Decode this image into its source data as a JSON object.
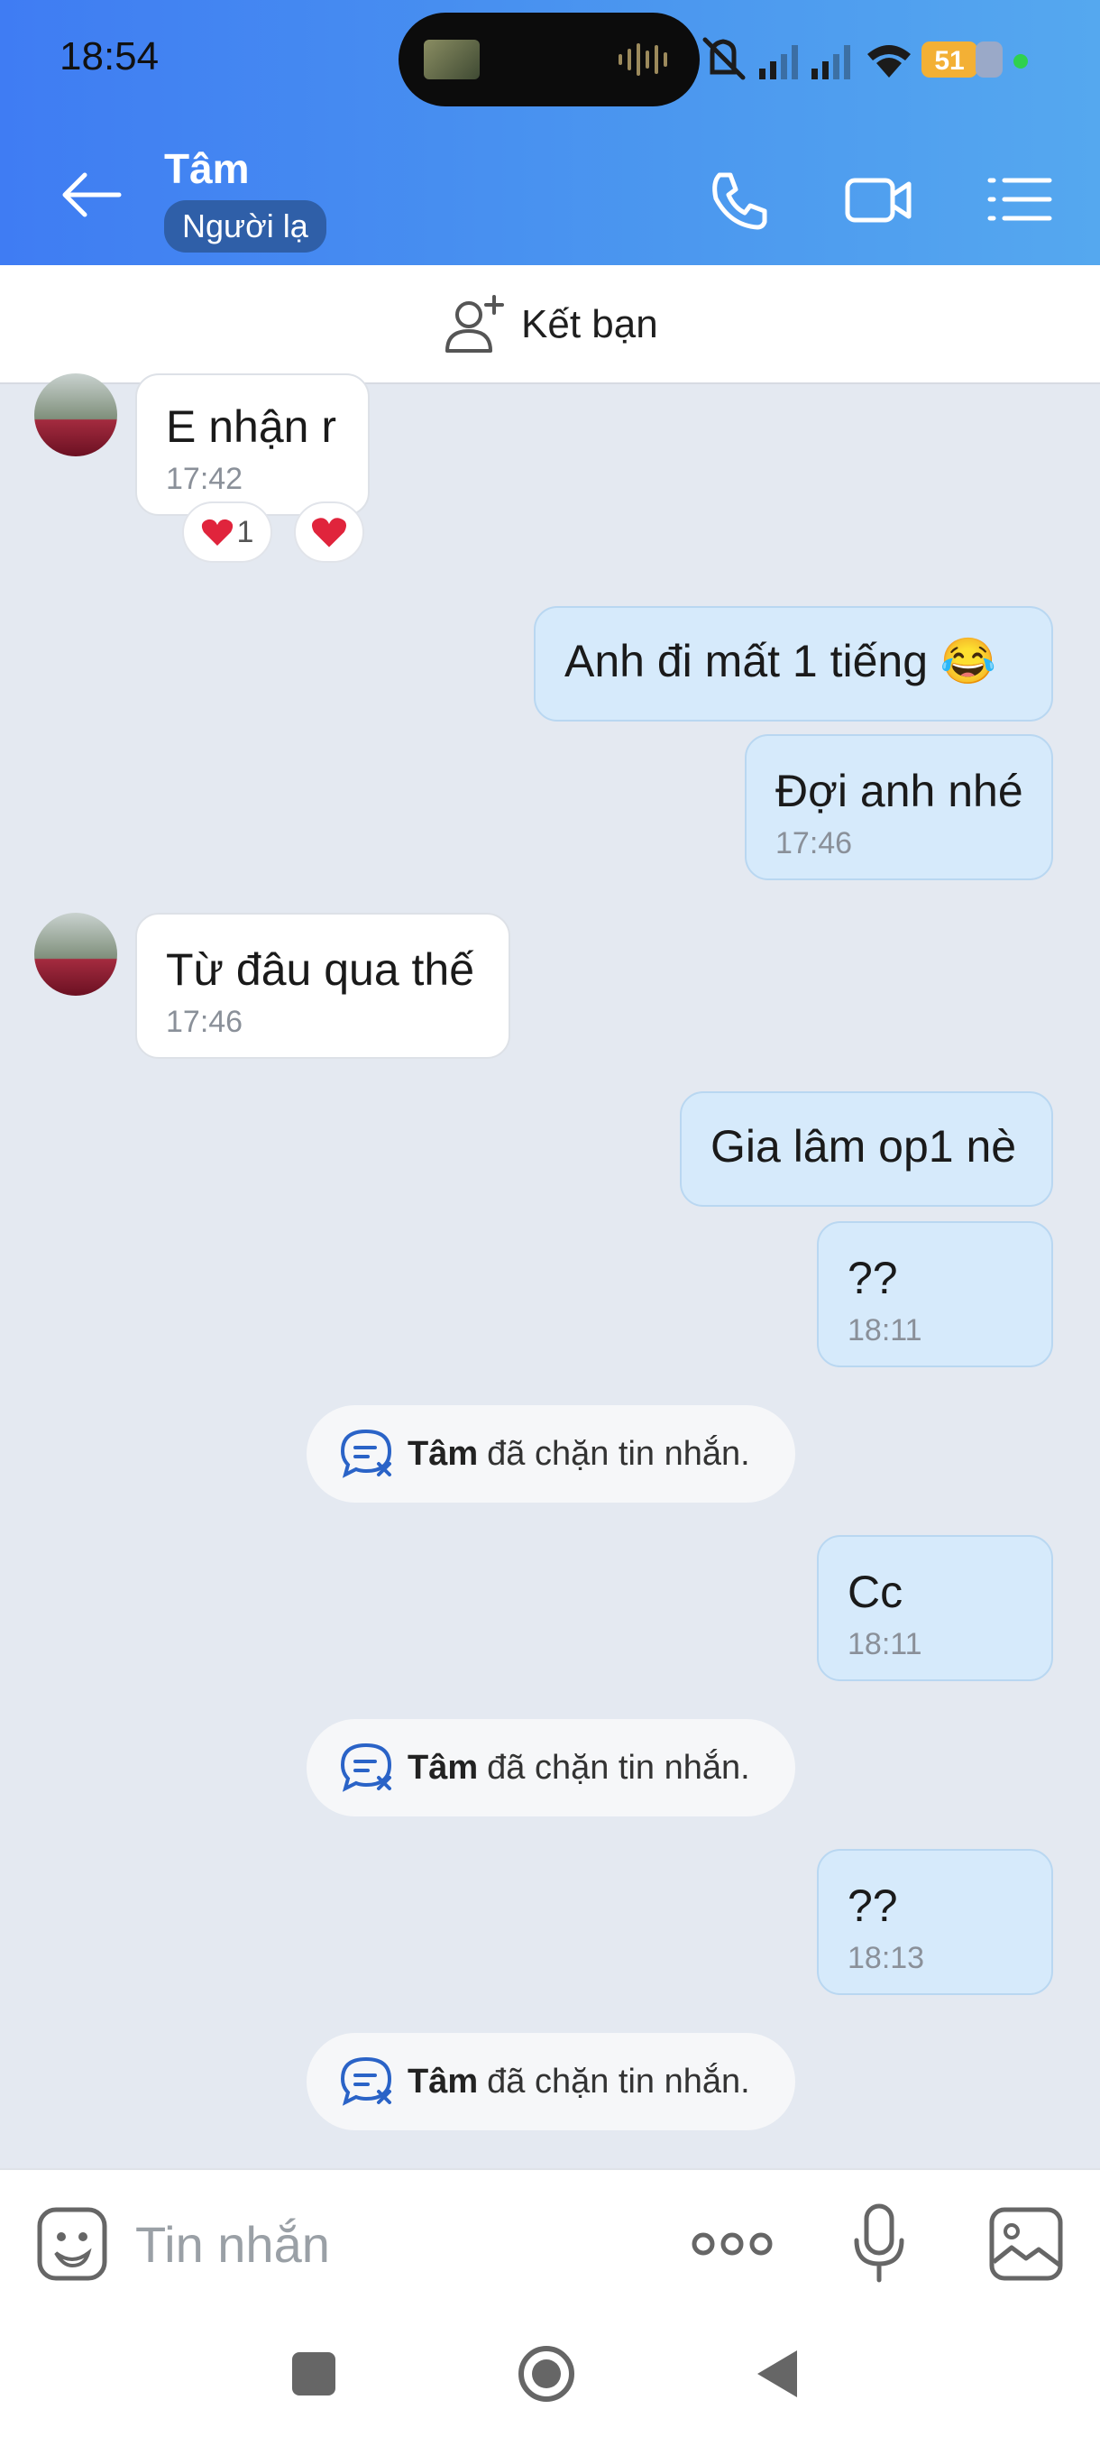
{
  "status_bar": {
    "time": "18:54",
    "battery": "51"
  },
  "header": {
    "title": "Tâm",
    "badge": "Người lạ"
  },
  "friend_bar": {
    "label": "Kết bạn"
  },
  "messages": [
    {
      "text": "E nhận r",
      "time": "17:42"
    },
    {
      "reaction_count": "1"
    },
    {
      "text": "Anh đi mất 1 tiếng 😂"
    },
    {
      "text": "Đợi anh nhé",
      "time": "17:46"
    },
    {
      "text": "Từ đâu qua thế",
      "time": "17:46"
    },
    {
      "text": "Gia lâm op1 nè"
    },
    {
      "text": "??",
      "time": "18:11"
    },
    {
      "text": "Cc",
      "time": "18:11"
    },
    {
      "text": "??",
      "time": "18:13"
    }
  ],
  "system_note": {
    "name": "Tâm",
    "text": "đã chặn tin nhắn."
  },
  "input": {
    "placeholder": "Tin nhắn"
  },
  "colors": {
    "header_start": "#3f7cf3",
    "header_end": "#55a8ef",
    "outgoing_bubble": "#d6eafb",
    "incoming_bubble": "#ffffff",
    "badge": "#2f5fa8"
  },
  "icons": [
    "back-arrow-icon",
    "phone-icon",
    "video-camera-icon",
    "menu-list-icon",
    "add-friend-icon",
    "heart-icon",
    "blocked-message-icon",
    "sticker-icon",
    "more-icon",
    "microphone-icon",
    "image-icon",
    "nav-square-icon",
    "nav-home-icon",
    "nav-back-icon"
  ]
}
